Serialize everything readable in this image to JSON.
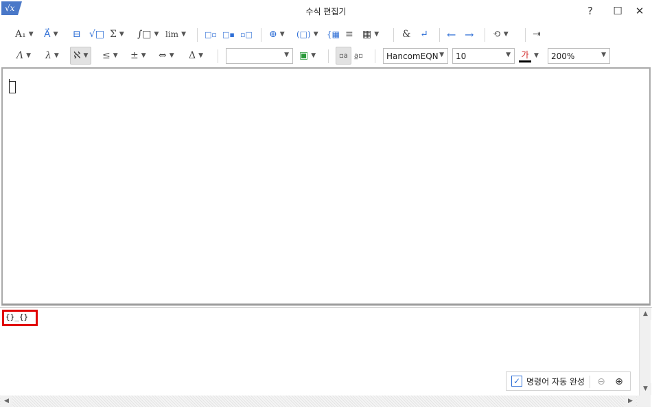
{
  "window": {
    "title": "수식 편집기",
    "app_icon_text": "√x",
    "controls": {
      "help": "?",
      "maximize": "☐",
      "close": "✕"
    }
  },
  "toolbar1": {
    "items": [
      {
        "name": "font-size-style",
        "glyph": "A₁"
      },
      {
        "name": "decoration",
        "glyph": "A⃗"
      },
      {
        "name": "fraction",
        "glyph": "⊟"
      },
      {
        "name": "root",
        "glyph": "√□"
      },
      {
        "name": "sum",
        "glyph": "Σ"
      },
      {
        "name": "integral",
        "glyph": "∫□"
      },
      {
        "name": "limit",
        "glyph": "lim"
      },
      {
        "name": "subscript-left",
        "glyph": "□▫"
      },
      {
        "name": "superscript",
        "glyph": "□▪"
      },
      {
        "name": "sub-super",
        "glyph": "▫□"
      },
      {
        "name": "stack",
        "glyph": "⊕"
      },
      {
        "name": "bracket",
        "glyph": "(□)"
      },
      {
        "name": "matrix-cases",
        "glyph": "{▦"
      },
      {
        "name": "lines",
        "glyph": "≡"
      },
      {
        "name": "matrix",
        "glyph": "▦"
      },
      {
        "name": "ampersand",
        "glyph": "&"
      },
      {
        "name": "newline",
        "glyph": "↵"
      },
      {
        "name": "back",
        "glyph": "←"
      },
      {
        "name": "forward",
        "glyph": "→"
      },
      {
        "name": "convert",
        "glyph": "⟲"
      },
      {
        "name": "insert",
        "glyph": "⇥"
      }
    ]
  },
  "toolbar2": {
    "items": [
      {
        "name": "greek-upper",
        "glyph": "Λ"
      },
      {
        "name": "greek-lower",
        "glyph": "λ"
      },
      {
        "name": "hebrew",
        "glyph": "ℵ"
      },
      {
        "name": "relations",
        "glyph": "≤"
      },
      {
        "name": "operators",
        "glyph": "±"
      },
      {
        "name": "arrows",
        "glyph": "⇔"
      },
      {
        "name": "misc-symbols",
        "glyph": "Δ"
      }
    ],
    "blank_combo_value": "",
    "font_combo_value": "HancomEQN",
    "size_combo_value": "10",
    "color_glyph": "가",
    "zoom_combo_value": "200%"
  },
  "script": {
    "text": "{}_{}"
  },
  "autocomplete": {
    "label": "명령어 자동 완성",
    "checked": true
  },
  "colors": {
    "accent": "#2f6fd6",
    "highlight_border": "#e10000",
    "font_color_bar": "#000000"
  }
}
